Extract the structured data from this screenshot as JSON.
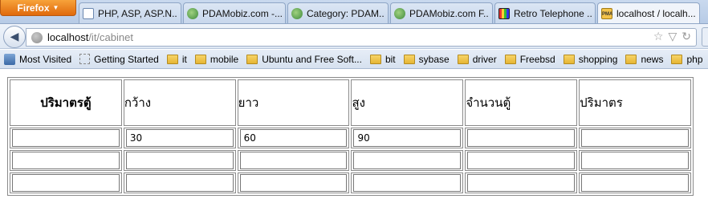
{
  "browser": {
    "menu_button_label": "Firefox",
    "tabs": [
      {
        "label": "PHP, ASP, ASP.N...",
        "icon": "page-icon"
      },
      {
        "label": "PDAMobiz.com -...",
        "icon": "pda-icon"
      },
      {
        "label": "Category: PDAM...",
        "icon": "pda-icon"
      },
      {
        "label": "PDAMobiz.com F...",
        "icon": "pda-icon"
      },
      {
        "label": "Retro Telephone ...",
        "icon": "tv-icon"
      },
      {
        "label": "localhost / localh...",
        "icon": "phpmyadmin-icon"
      }
    ],
    "url_host": "localhost",
    "url_path": "/it/cabinet",
    "bookmarks": [
      {
        "label": "Most Visited",
        "icon": "most-visited-icon"
      },
      {
        "label": "Getting Started",
        "icon": "getting-started-icon"
      },
      {
        "label": "it",
        "icon": "folder-icon"
      },
      {
        "label": "mobile",
        "icon": "folder-icon"
      },
      {
        "label": "Ubuntu and Free Soft...",
        "icon": "folder-icon"
      },
      {
        "label": "bit",
        "icon": "folder-icon"
      },
      {
        "label": "sybase",
        "icon": "folder-icon"
      },
      {
        "label": "driver",
        "icon": "folder-icon"
      },
      {
        "label": "Freebsd",
        "icon": "folder-icon"
      },
      {
        "label": "shopping",
        "icon": "folder-icon"
      },
      {
        "label": "news",
        "icon": "folder-icon"
      },
      {
        "label": "php",
        "icon": "folder-icon"
      }
    ]
  },
  "table": {
    "headers": [
      "ปริมาตรตู้",
      "กว้าง",
      "ยาว",
      "สูง",
      "จำนวนตู้",
      "ปริมาตร"
    ],
    "rows": [
      [
        "",
        "30",
        "60",
        "90",
        "",
        ""
      ],
      [
        "",
        "",
        "",
        "",
        "",
        ""
      ],
      [
        "",
        "",
        "",
        "",
        "",
        ""
      ]
    ]
  },
  "colors": {
    "firefox_button": "#e0690c",
    "tab_strip": "#c9d9ee"
  }
}
